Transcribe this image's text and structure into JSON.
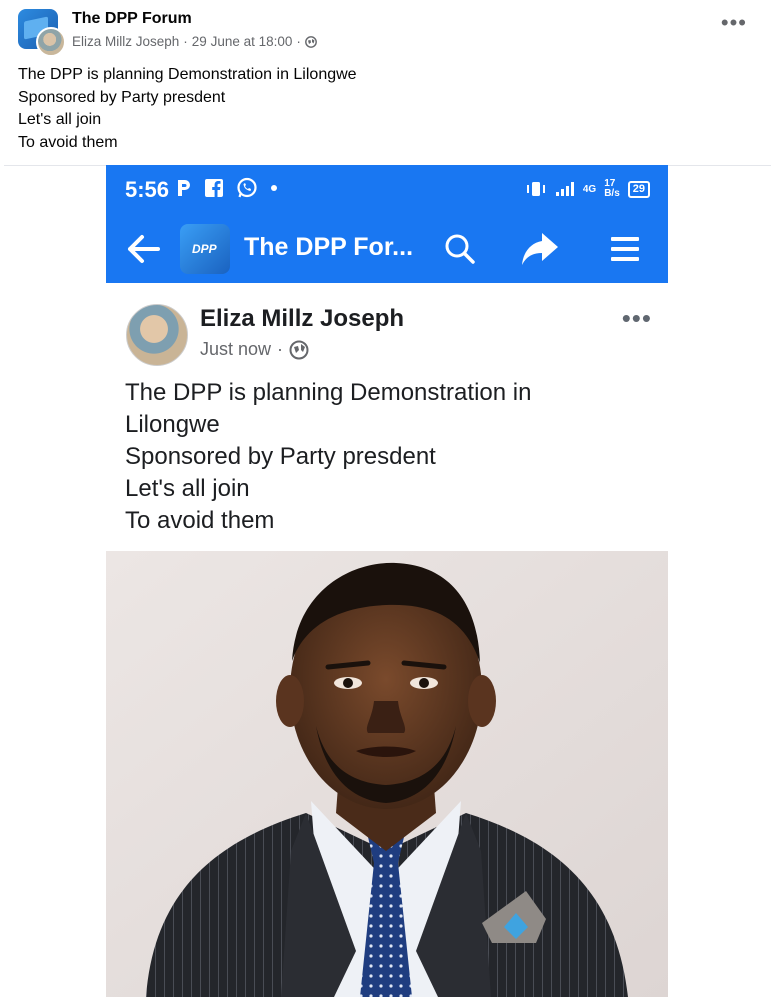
{
  "post": {
    "group_name": "The DPP Forum",
    "author": "Eliza Millz Joseph",
    "separator1": "·",
    "date": "29 June at 18:00",
    "separator2": "·",
    "more": "•••",
    "text_lines": [
      "The DPP is planning Demonstration in Lilongwe",
      "Sponsored by Party presdent",
      "Let's all join",
      "To avoid them"
    ]
  },
  "screenshot": {
    "status_bar": {
      "time": "5:56",
      "network_label": "4G",
      "speed_value": "17",
      "speed_unit": "B/s",
      "battery": "29"
    },
    "app_bar": {
      "logo_text": "DPP",
      "title": "The DPP For..."
    },
    "post": {
      "author": "Eliza Millz Joseph",
      "time": "Just now",
      "separator": "·",
      "more": "•••",
      "text_lines": [
        "The DPP is planning Demonstration in",
        "Lilongwe",
        "Sponsored by Party presdent",
        "Let's all join",
        "To avoid them"
      ]
    }
  },
  "colors": {
    "facebook_blue": "#1977f2",
    "secondary_text": "#65676b"
  }
}
